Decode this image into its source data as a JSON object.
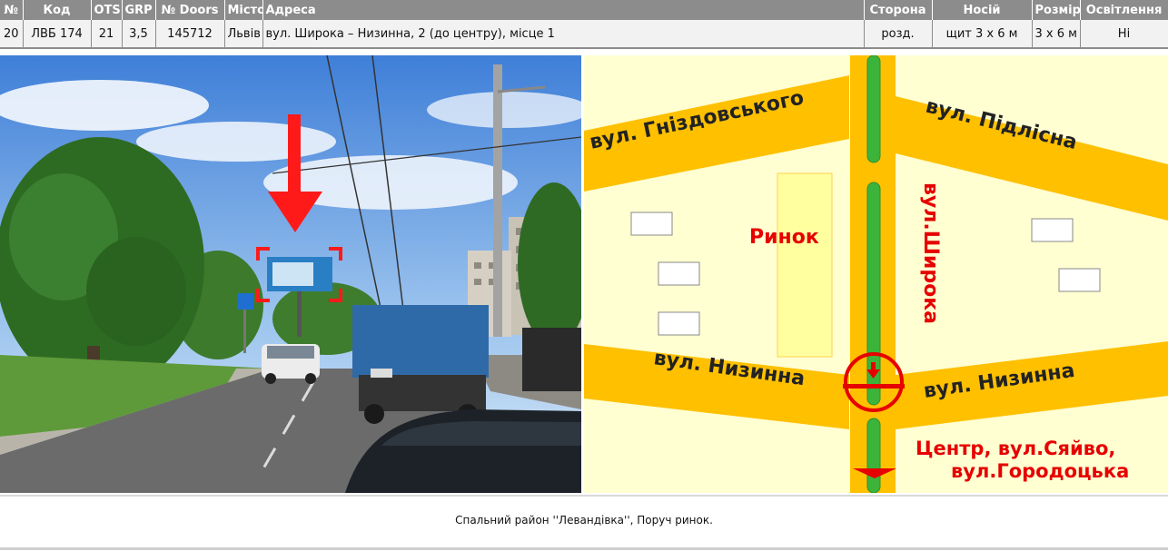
{
  "table": {
    "headers": [
      "№",
      "Код",
      "OTS",
      "GRP",
      "№ Doors",
      "Місто",
      "Адреса",
      "Сторона",
      "Носій",
      "Розмір",
      "Освітлення"
    ],
    "row": {
      "num": "20",
      "code": "ЛВБ 174",
      "ots": "21",
      "grp": "3,5",
      "doors": "145712",
      "city": "Львів",
      "address": "вул. Широка – Низинна, 2 (до центру), місце 1",
      "side": "розд.",
      "carrier": "щит 3 х 6 м",
      "size": "3 х 6 м",
      "lighting": "Ні"
    }
  },
  "map": {
    "labels": {
      "gnizd": "вул. Гніздовського",
      "pidlisna": "вул. Підлісна",
      "shyroka": "вул.Широка",
      "rynok": "Ринок",
      "nyzynna_left": "вул. Низинна",
      "nyzynna_right": "вул. Низинна",
      "center_1": "Центр,  вул.Сяйво,",
      "center_2": "вул.Городоцька"
    },
    "colors": {
      "background": "#ffffd2",
      "road": "#ffc000",
      "median": "#3cb43c",
      "label_red": "#e60000",
      "label_dark": "#222222"
    }
  },
  "caption": "Спальний район ''Левандівка'', Поруч ринок."
}
